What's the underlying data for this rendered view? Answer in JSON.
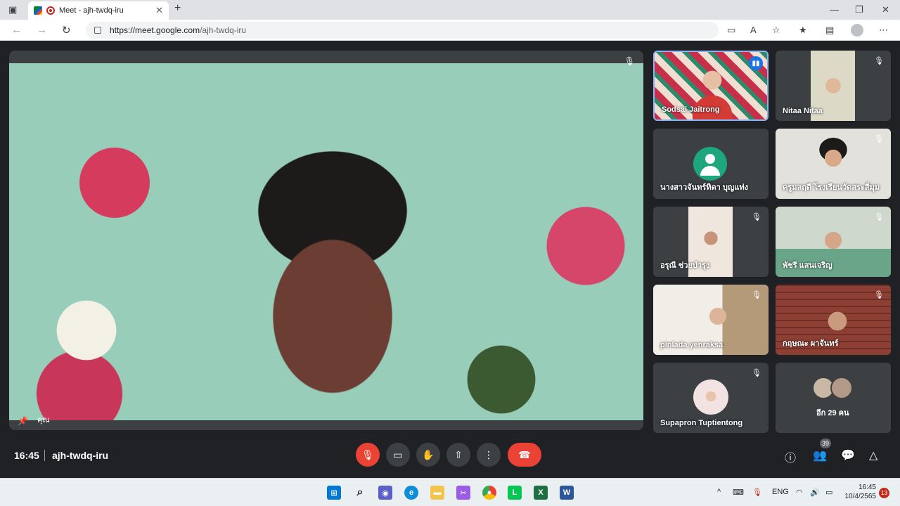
{
  "browser": {
    "tab_title": "Meet - ajh-twdq-iru",
    "tab_close": "✕",
    "new_tab": "+",
    "url_host": "https://meet.google.com",
    "url_path": "/ajh-twdq-iru"
  },
  "main": {
    "name": "คุณ"
  },
  "tiles": [
    {
      "name": "Sodsai Jaitrong",
      "speaking": true
    },
    {
      "name": "Nitaa Nitaa",
      "muted": true
    },
    {
      "name": "นางสาวจันทร์ทิดา บุญแท่ง"
    },
    {
      "name": "ครูมลฤดี โรงเรียนวัดสระสี่มุม",
      "muted": true
    },
    {
      "name": "อรุณี ช่วยบำรุง",
      "muted": true
    },
    {
      "name": "พัชรี แสนเจริญ",
      "muted": true
    },
    {
      "name": "pinlada yenraksa",
      "muted": true
    },
    {
      "name": "กฤษณะ ผาจันทร์",
      "muted": true
    },
    {
      "name": "Supapron Tuptientong",
      "muted": true
    },
    {
      "name": "อีก 29 คน"
    }
  ],
  "bottom": {
    "time": "16:45",
    "meeting_code": "ajh-twdq-iru",
    "participant_count": "39"
  },
  "taskbar": {
    "lang": "ENG",
    "time": "16:45",
    "date": "10/4/2565",
    "notifications": "13"
  }
}
